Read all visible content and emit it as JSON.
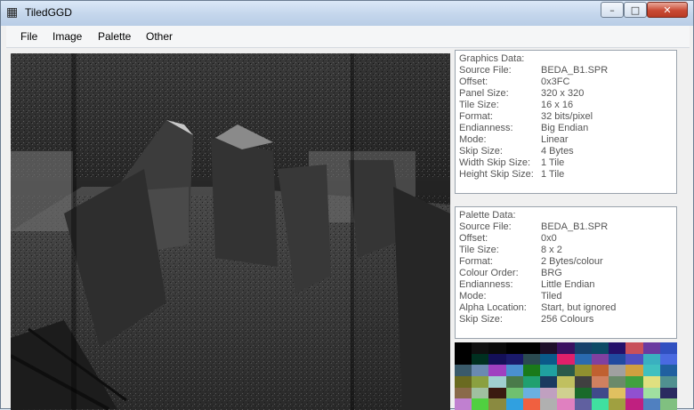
{
  "window": {
    "title": "TiledGGD"
  },
  "menu": [
    "File",
    "Image",
    "Palette",
    "Other"
  ],
  "graphics": {
    "title": "Graphics Data:",
    "rows": [
      {
        "k": "Source File:",
        "v": "BEDA_B1.SPR"
      },
      {
        "k": "Offset:",
        "v": "0x3FC"
      },
      {
        "k": "Panel Size:",
        "v": "320 x 320"
      },
      {
        "k": "Tile Size:",
        "v": "16 x 16"
      },
      {
        "k": "Format:",
        "v": "32 bits/pixel"
      },
      {
        "k": "Endianness:",
        "v": "Big Endian"
      },
      {
        "k": "Mode:",
        "v": "Linear"
      },
      {
        "k": "Skip Size:",
        "v": "4 Bytes"
      },
      {
        "k": "Width Skip Size:",
        "v": "1 Tile"
      },
      {
        "k": "Height Skip Size:",
        "v": "1 Tile"
      }
    ]
  },
  "palette": {
    "title": "Palette Data:",
    "rows": [
      {
        "k": "Source File:",
        "v": "BEDA_B1.SPR"
      },
      {
        "k": "Offset:",
        "v": "0x0"
      },
      {
        "k": "Tile Size:",
        "v": "8 x 2"
      },
      {
        "k": "Format:",
        "v": "2 Bytes/colour"
      },
      {
        "k": "Colour Order:",
        "v": "BRG"
      },
      {
        "k": "Endianness:",
        "v": "Little Endian"
      },
      {
        "k": "Mode:",
        "v": "Tiled"
      },
      {
        "k": "Alpha Location:",
        "v": "Start, but ignored"
      },
      {
        "k": "Skip Size:",
        "v": "256 Colours"
      }
    ]
  },
  "swatch_colors": [
    "#000000",
    "#101010",
    "#0a0a0a",
    "#000000",
    "#000000",
    "#1e0f2a",
    "#3a1060",
    "#16406a",
    "#0c4a66",
    "#24106a",
    "#c8505a",
    "#6a3aa0",
    "#3050c0",
    "#000000",
    "#003020",
    "#141058",
    "#1a1a6a",
    "#2a4a50",
    "#0a5a8a",
    "#e0206a",
    "#2a6ab0",
    "#8040a0",
    "#204aa0",
    "#5050c0",
    "#3ab0c0",
    "#4a6ae0",
    "#3a5a6a",
    "#6a8ab0",
    "#a040c0",
    "#4a90d0",
    "#1a7a1a",
    "#20a0a0",
    "#2a5a4a",
    "#909030",
    "#c06030",
    "#a0a0a0",
    "#d0a040",
    "#40c0c0",
    "#2060a0",
    "#6a6a20",
    "#8aa040",
    "#a0d0d0",
    "#4a7a4a",
    "#20a070",
    "#1a3a60",
    "#c0c060",
    "#404040",
    "#d08060",
    "#6a8a6a",
    "#40a040",
    "#e0e080",
    "#509090",
    "#8a6a4a",
    "#a0c0a0",
    "#3a1a10",
    "#70c070",
    "#6ab0e0",
    "#c0a0c0",
    "#d0d090",
    "#1a6a2a",
    "#404a8a",
    "#e0c060",
    "#9050d0",
    "#a0e0a0",
    "#2a2a60",
    "#c080d0",
    "#50d040",
    "#8a8a40",
    "#30a0e0",
    "#f06040",
    "#b0b0b0",
    "#e080c0",
    "#6060a0",
    "#40e0a0",
    "#a0a040",
    "#c02080",
    "#5080c0",
    "#80c080"
  ]
}
